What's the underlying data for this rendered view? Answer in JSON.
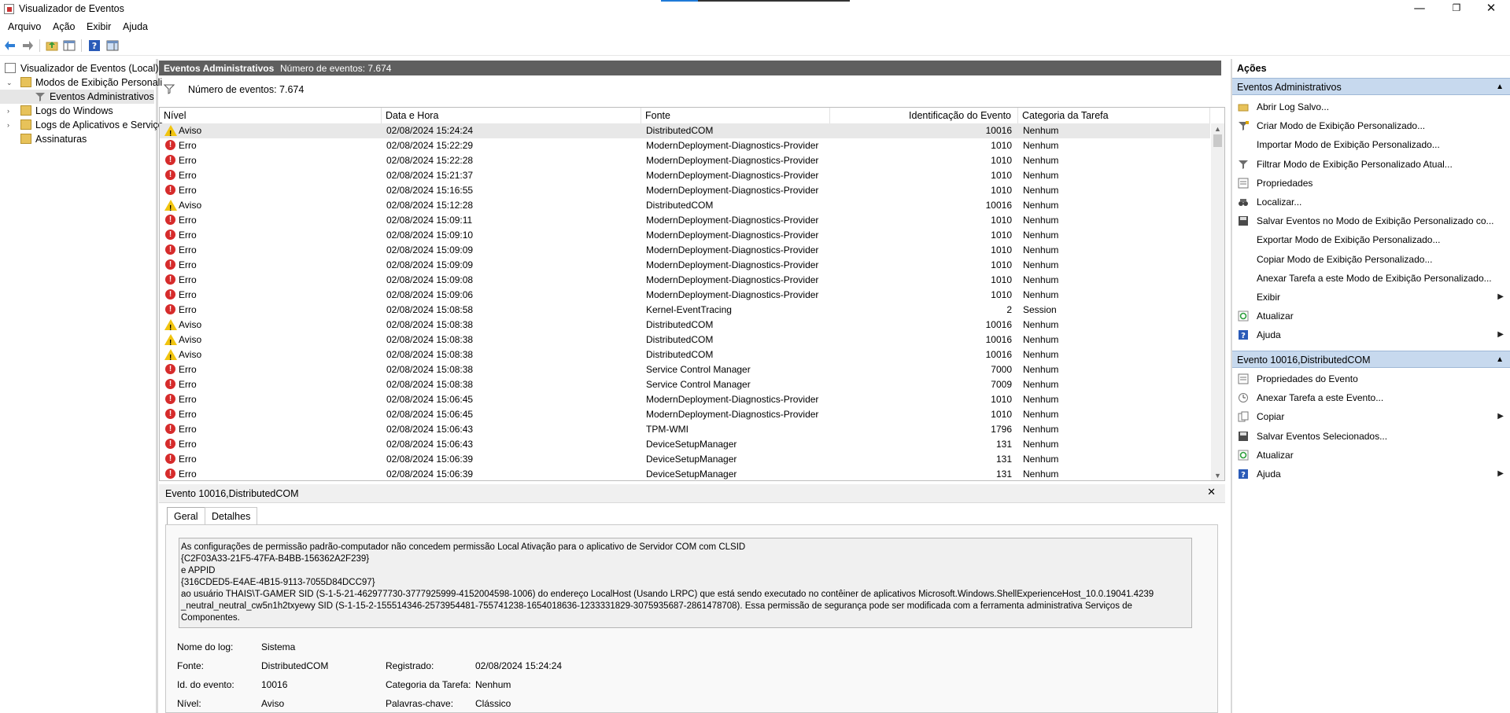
{
  "window": {
    "title": "Visualizador de Eventos",
    "minimize": "—",
    "maximize": "❐",
    "close": "✕"
  },
  "menu": [
    "Arquivo",
    "Ação",
    "Exibir",
    "Ajuda"
  ],
  "tree": {
    "root": "Visualizador de Eventos (Local)",
    "custom_views": "Modos de Exibição Personali",
    "admin_events": "Eventos Administrativos",
    "windows_logs": "Logs do Windows",
    "app_logs": "Logs de Aplicativos e Serviço",
    "subscriptions": "Assinaturas"
  },
  "header": {
    "title": "Eventos Administrativos",
    "count": "Número de eventos: 7.674"
  },
  "filter": {
    "text": "Número de eventos: 7.674"
  },
  "columns": [
    "Nível",
    "Data e Hora",
    "Fonte",
    "Identificação do Evento",
    "Categoria da Tarefa"
  ],
  "rows": [
    {
      "level": "Aviso",
      "type": "warn",
      "date": "02/08/2024 15:24:24",
      "source": "DistributedCOM",
      "id": "10016",
      "cat": "Nenhum"
    },
    {
      "level": "Erro",
      "type": "err",
      "date": "02/08/2024 15:22:29",
      "source": "ModernDeployment-Diagnostics-Provider",
      "id": "1010",
      "cat": "Nenhum"
    },
    {
      "level": "Erro",
      "type": "err",
      "date": "02/08/2024 15:22:28",
      "source": "ModernDeployment-Diagnostics-Provider",
      "id": "1010",
      "cat": "Nenhum"
    },
    {
      "level": "Erro",
      "type": "err",
      "date": "02/08/2024 15:21:37",
      "source": "ModernDeployment-Diagnostics-Provider",
      "id": "1010",
      "cat": "Nenhum"
    },
    {
      "level": "Erro",
      "type": "err",
      "date": "02/08/2024 15:16:55",
      "source": "ModernDeployment-Diagnostics-Provider",
      "id": "1010",
      "cat": "Nenhum"
    },
    {
      "level": "Aviso",
      "type": "warn",
      "date": "02/08/2024 15:12:28",
      "source": "DistributedCOM",
      "id": "10016",
      "cat": "Nenhum"
    },
    {
      "level": "Erro",
      "type": "err",
      "date": "02/08/2024 15:09:11",
      "source": "ModernDeployment-Diagnostics-Provider",
      "id": "1010",
      "cat": "Nenhum"
    },
    {
      "level": "Erro",
      "type": "err",
      "date": "02/08/2024 15:09:10",
      "source": "ModernDeployment-Diagnostics-Provider",
      "id": "1010",
      "cat": "Nenhum"
    },
    {
      "level": "Erro",
      "type": "err",
      "date": "02/08/2024 15:09:09",
      "source": "ModernDeployment-Diagnostics-Provider",
      "id": "1010",
      "cat": "Nenhum"
    },
    {
      "level": "Erro",
      "type": "err",
      "date": "02/08/2024 15:09:09",
      "source": "ModernDeployment-Diagnostics-Provider",
      "id": "1010",
      "cat": "Nenhum"
    },
    {
      "level": "Erro",
      "type": "err",
      "date": "02/08/2024 15:09:08",
      "source": "ModernDeployment-Diagnostics-Provider",
      "id": "1010",
      "cat": "Nenhum"
    },
    {
      "level": "Erro",
      "type": "err",
      "date": "02/08/2024 15:09:06",
      "source": "ModernDeployment-Diagnostics-Provider",
      "id": "1010",
      "cat": "Nenhum"
    },
    {
      "level": "Erro",
      "type": "err",
      "date": "02/08/2024 15:08:58",
      "source": "Kernel-EventTracing",
      "id": "2",
      "cat": "Session"
    },
    {
      "level": "Aviso",
      "type": "warn",
      "date": "02/08/2024 15:08:38",
      "source": "DistributedCOM",
      "id": "10016",
      "cat": "Nenhum"
    },
    {
      "level": "Aviso",
      "type": "warn",
      "date": "02/08/2024 15:08:38",
      "source": "DistributedCOM",
      "id": "10016",
      "cat": "Nenhum"
    },
    {
      "level": "Aviso",
      "type": "warn",
      "date": "02/08/2024 15:08:38",
      "source": "DistributedCOM",
      "id": "10016",
      "cat": "Nenhum"
    },
    {
      "level": "Erro",
      "type": "err",
      "date": "02/08/2024 15:08:38",
      "source": "Service Control Manager",
      "id": "7000",
      "cat": "Nenhum"
    },
    {
      "level": "Erro",
      "type": "err",
      "date": "02/08/2024 15:08:38",
      "source": "Service Control Manager",
      "id": "7009",
      "cat": "Nenhum"
    },
    {
      "level": "Erro",
      "type": "err",
      "date": "02/08/2024 15:06:45",
      "source": "ModernDeployment-Diagnostics-Provider",
      "id": "1010",
      "cat": "Nenhum"
    },
    {
      "level": "Erro",
      "type": "err",
      "date": "02/08/2024 15:06:45",
      "source": "ModernDeployment-Diagnostics-Provider",
      "id": "1010",
      "cat": "Nenhum"
    },
    {
      "level": "Erro",
      "type": "err",
      "date": "02/08/2024 15:06:43",
      "source": "TPM-WMI",
      "id": "1796",
      "cat": "Nenhum"
    },
    {
      "level": "Erro",
      "type": "err",
      "date": "02/08/2024 15:06:43",
      "source": "DeviceSetupManager",
      "id": "131",
      "cat": "Nenhum"
    },
    {
      "level": "Erro",
      "type": "err",
      "date": "02/08/2024 15:06:39",
      "source": "DeviceSetupManager",
      "id": "131",
      "cat": "Nenhum"
    },
    {
      "level": "Erro",
      "type": "err",
      "date": "02/08/2024 15:06:39",
      "source": "DeviceSetupManager",
      "id": "131",
      "cat": "Nenhum"
    }
  ],
  "detail": {
    "title": "Evento 10016,DistributedCOM",
    "tabs": [
      "Geral",
      "Detalhes"
    ],
    "message": [
      "As configurações de permissão padrão-computador não concedem permissão Local Ativação para o aplicativo de Servidor COM com CLSID",
      "{C2F03A33-21F5-47FA-B4BB-156362A2F239}",
      " e APPID",
      "{316CDED5-E4AE-4B15-9113-7055D84DCC97}",
      " ao usuário THAIS\\T-GAMER SID (S-1-5-21-462977730-3777925999-4152004598-1006) do endereço LocalHost (Usando LRPC) que está sendo executado no contêiner de aplicativos Microsoft.Windows.ShellExperienceHost_10.0.19041.4239",
      "_neutral_neutral_cw5n1h2txyewy SID (S-1-15-2-155514346-2573954481-755741238-1654018636-1233331829-3075935687-2861478708). Essa permissão de segurança pode ser modificada com a ferramenta administrativa Serviços de Componentes."
    ],
    "fields": {
      "log_label": "Nome do log:",
      "log_value": "Sistema",
      "source_label": "Fonte:",
      "source_value": "DistributedCOM",
      "recorded_label": "Registrado:",
      "recorded_value": "02/08/2024 15:24:24",
      "id_label": "Id. do evento:",
      "id_value": "10016",
      "task_label": "Categoria da Tarefa:",
      "task_value": "Nenhum",
      "level_label": "Nível:",
      "level_value": "Aviso",
      "keywords_label": "Palavras-chave:",
      "keywords_value": "Clássico"
    }
  },
  "actions": {
    "title": "Ações",
    "section1": "Eventos Administrativos",
    "items1": [
      {
        "label": "Abrir Log Salvo...",
        "icon": "open-folder-icon"
      },
      {
        "label": "Criar Modo de Exibição Personalizado...",
        "icon": "filter-create-icon"
      },
      {
        "label": "Importar Modo de Exibição Personalizado...",
        "icon": ""
      },
      {
        "label": "Filtrar Modo de Exibição Personalizado Atual...",
        "icon": "filter-icon"
      },
      {
        "label": "Propriedades",
        "icon": "properties-icon"
      },
      {
        "label": "Localizar...",
        "icon": "binoculars-icon"
      },
      {
        "label": "Salvar Eventos no Modo de Exibição Personalizado co...",
        "icon": "save-icon"
      },
      {
        "label": "Exportar Modo de Exibição Personalizado...",
        "icon": ""
      },
      {
        "label": "Copiar Modo de Exibição Personalizado...",
        "icon": ""
      },
      {
        "label": "Anexar Tarefa a este Modo de Exibição Personalizado...",
        "icon": ""
      },
      {
        "label": "Exibir",
        "icon": "",
        "submenu": true
      },
      {
        "label": "Atualizar",
        "icon": "refresh-icon"
      },
      {
        "label": "Ajuda",
        "icon": "help-icon",
        "submenu": true
      }
    ],
    "section2": "Evento 10016,DistributedCOM",
    "items2": [
      {
        "label": "Propriedades do Evento",
        "icon": "properties-icon"
      },
      {
        "label": "Anexar Tarefa a este Evento...",
        "icon": "task-icon"
      },
      {
        "label": "Copiar",
        "icon": "copy-icon",
        "submenu": true
      },
      {
        "label": "Salvar Eventos Selecionados...",
        "icon": "save-icon"
      },
      {
        "label": "Atualizar",
        "icon": "refresh-icon"
      },
      {
        "label": "Ajuda",
        "icon": "help-icon",
        "submenu": true
      }
    ]
  }
}
